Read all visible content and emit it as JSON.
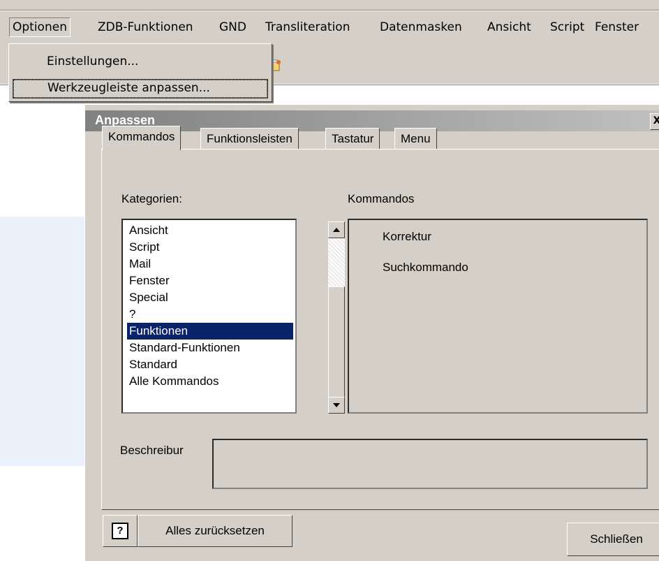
{
  "menubar": {
    "items": [
      {
        "label": "Optionen"
      },
      {
        "label": "ZDB-Funktionen"
      },
      {
        "label": "GND"
      },
      {
        "label": "Transliteration"
      },
      {
        "label": "Datenmasken"
      },
      {
        "label": "Ansicht"
      },
      {
        "label": "Script"
      },
      {
        "label": "Fenster"
      }
    ]
  },
  "options_menu": {
    "items": [
      {
        "label": "Einstellungen..."
      },
      {
        "label": "Werkzeugleiste anpassen..."
      }
    ]
  },
  "dialog": {
    "title": "Anpassen",
    "close_glyph": "X",
    "tabs": [
      {
        "label": "Kommandos"
      },
      {
        "label": "Funktionsleisten"
      },
      {
        "label": "Tastatur"
      },
      {
        "label": "Menu"
      }
    ],
    "categories_label": "Kategorien:",
    "commands_label": "Kommandos",
    "categories": [
      {
        "label": "Ansicht"
      },
      {
        "label": "Script"
      },
      {
        "label": "Mail"
      },
      {
        "label": "Fenster"
      },
      {
        "label": "Special"
      },
      {
        "label": "?"
      },
      {
        "label": "Funktionen"
      },
      {
        "label": "Standard-Funktionen"
      },
      {
        "label": "Standard"
      },
      {
        "label": "Alle Kommandos"
      }
    ],
    "selected_category": "Funktionen",
    "commands": [
      {
        "label": "Korrektur"
      },
      {
        "label": "Suchkommando"
      }
    ],
    "description_label": "Beschreibur",
    "help_glyph": "?",
    "reset_button": "Alles zurücksetzen",
    "close_button": "Schließen"
  },
  "colors": {
    "face": "#d4d0c8",
    "selection": "#0a246a",
    "title_gradient_start": "#808080"
  },
  "icons": {
    "toolbar_icon": "toolbar-button-icon",
    "scroll_up": "scroll-up-arrow-icon",
    "scroll_down": "scroll-down-arrow-icon",
    "help": "help-question-icon"
  }
}
